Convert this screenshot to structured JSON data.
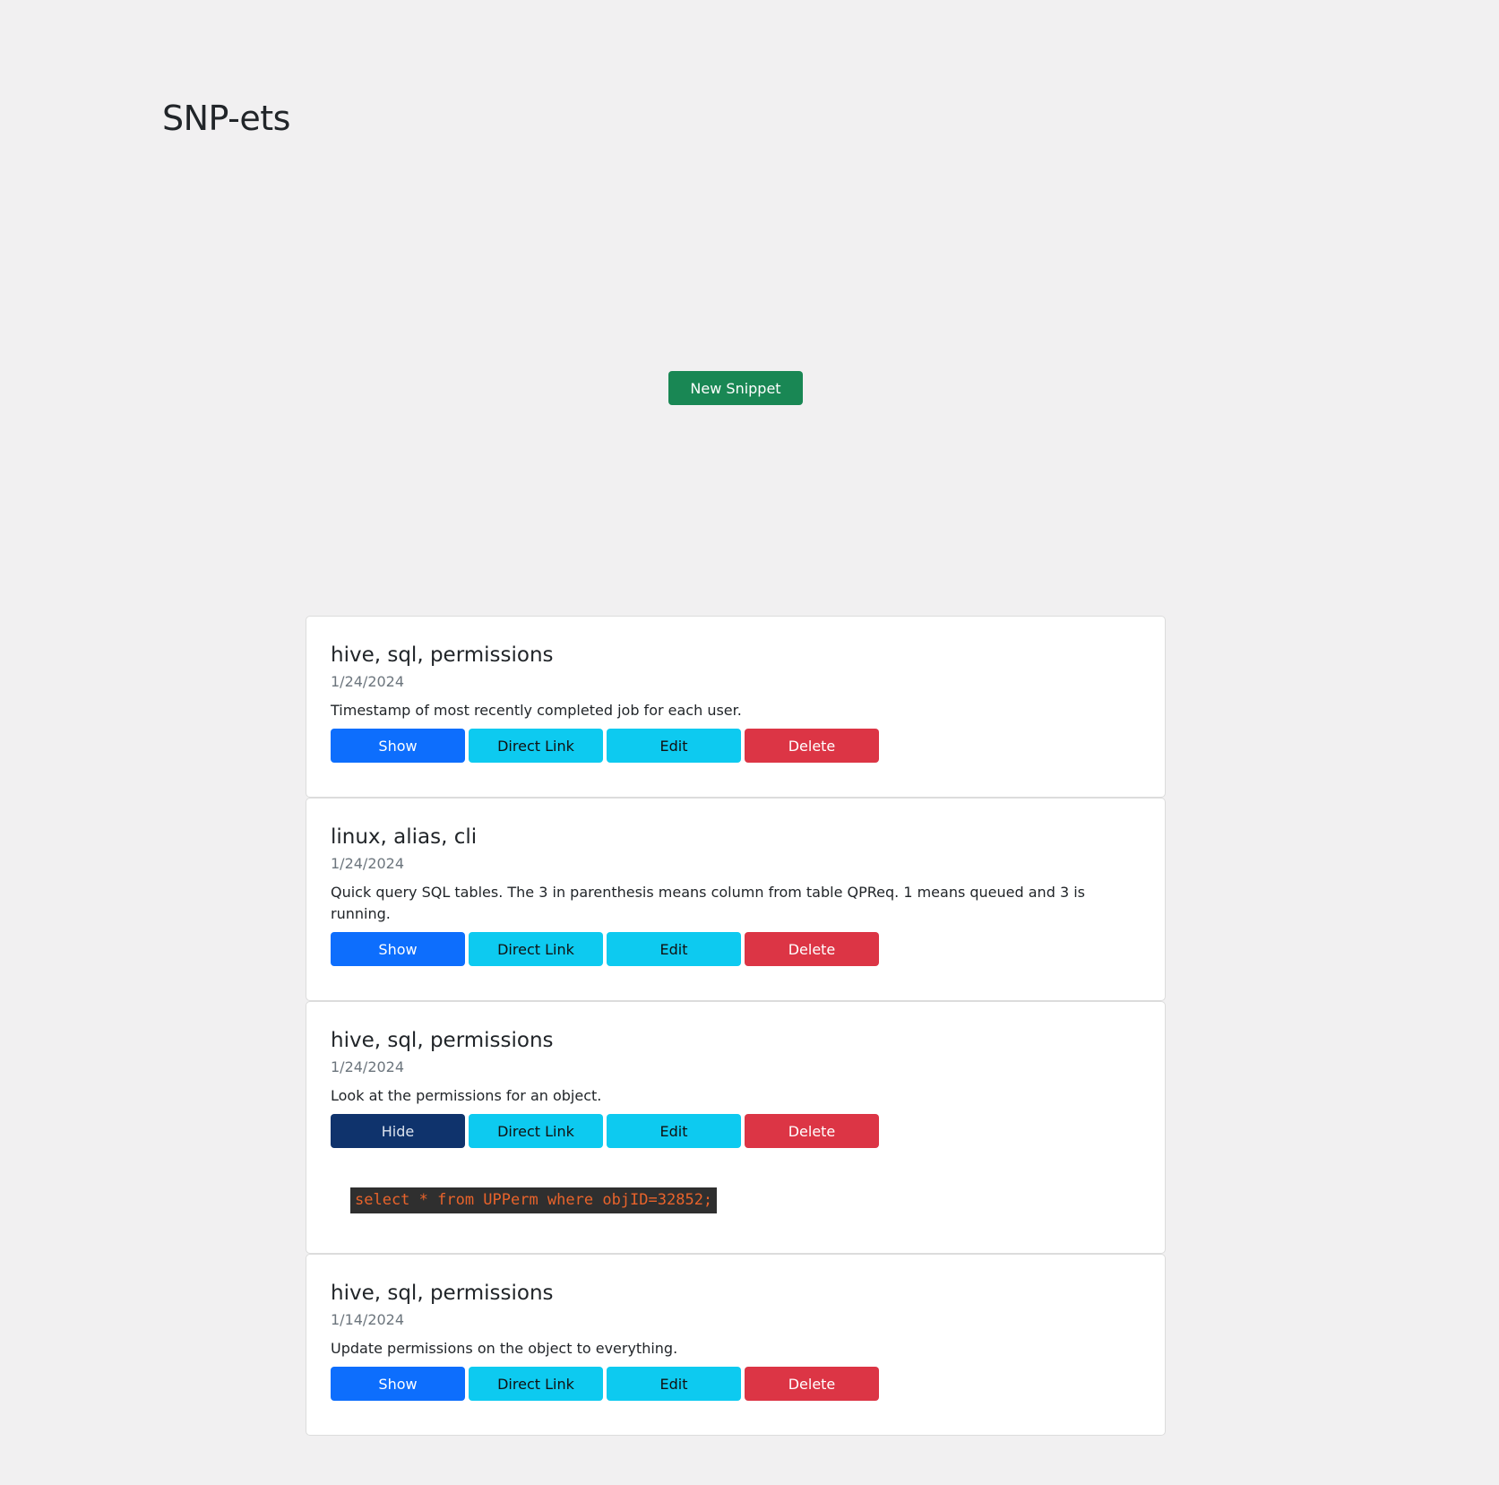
{
  "header": {
    "title": "SNP-ets"
  },
  "actions": {
    "new_snippet_label": "New Snippet"
  },
  "snippets": [
    {
      "title": "hive, sql, permissions",
      "date": "1/24/2024",
      "description": "Timestamp of most recently completed job for each user.",
      "toggle_label": "Show",
      "direct_link_label": "Direct Link",
      "edit_label": "Edit",
      "delete_label": "Delete"
    },
    {
      "title": "linux, alias, cli",
      "date": "1/24/2024",
      "description": "Quick query SQL tables. The 3 in parenthesis means column from table QPReq. 1 means queued and 3 is running.",
      "toggle_label": "Show",
      "direct_link_label": "Direct Link",
      "edit_label": "Edit",
      "delete_label": "Delete"
    },
    {
      "title": "hive, sql, permissions",
      "date": "1/24/2024",
      "description": "Look at the permissions for an object.",
      "toggle_label": "Hide",
      "direct_link_label": "Direct Link",
      "edit_label": "Edit",
      "delete_label": "Delete",
      "code": "select * from UPPerm where objID=32852;"
    },
    {
      "title": "hive, sql, permissions",
      "date": "1/14/2024",
      "description": "Update permissions on the object to everything.",
      "toggle_label": "Show",
      "direct_link_label": "Direct Link",
      "edit_label": "Edit",
      "delete_label": "Delete"
    }
  ],
  "colors": {
    "background": "#f1f0f1",
    "new_snippet": "#198754",
    "show": "#0d6efd",
    "hide": "#0f336c",
    "direct_link": "#0dcaf0",
    "edit": "#0dcaf0",
    "delete": "#dc3545",
    "code_bg": "#2f2f2f",
    "code_text": "#e8632b"
  }
}
